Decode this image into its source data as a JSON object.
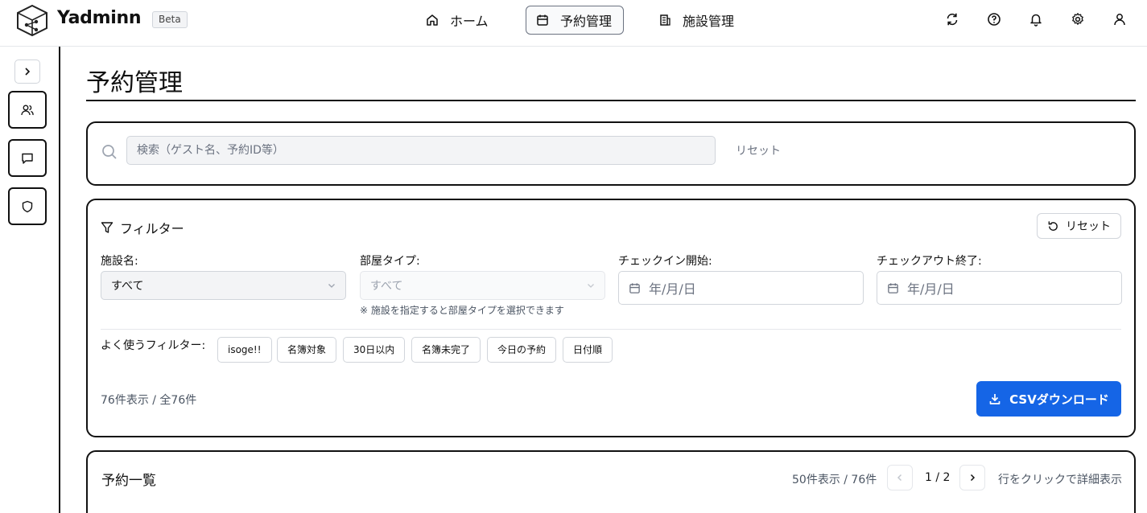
{
  "app": {
    "brand": "Yadminn",
    "badge": "Beta"
  },
  "nav": [
    {
      "label": "ホーム",
      "icon": "home-icon"
    },
    {
      "label": "予約管理",
      "icon": "calendar-icon",
      "active": true
    },
    {
      "label": "施設管理",
      "icon": "building-icon"
    }
  ],
  "header_icons": [
    "refresh-icon",
    "help-icon",
    "bell-icon",
    "gear-icon",
    "user-icon"
  ],
  "sidebar": {
    "items": [
      "users-icon",
      "message-icon",
      "shield-icon"
    ]
  },
  "page": {
    "title": "予約管理"
  },
  "search": {
    "placeholder": "検索（ゲスト名、予約ID等）",
    "value": "",
    "reset_label": "リセット"
  },
  "filters": {
    "title": "フィルター",
    "reset_label": "リセット",
    "facility": {
      "label": "施設名:",
      "value": "すべて"
    },
    "room_type": {
      "label": "部屋タイプ:",
      "value": "すべて",
      "helper": "※ 施設を指定すると部屋タイプを選択できます"
    },
    "checkin": {
      "label": "チェックイン開始:",
      "placeholder": "年/月/日"
    },
    "checkout": {
      "label": "チェックアウト終了:",
      "placeholder": "年/月/日"
    },
    "quick_label": "よく使うフィルター:",
    "quick": [
      "isoge!!",
      "名簿対象",
      "30日以内",
      "名簿未完了",
      "今日の予約",
      "日付順"
    ],
    "count_text": "76件表示 / 全76件",
    "csv_label": "CSVダウンロード"
  },
  "list": {
    "title": "予約一覧",
    "meta": "50件表示 / 76件",
    "page_text": "1 / 2",
    "hint": "行をクリックで詳細表示"
  },
  "colors": {
    "primary": "#1565e6",
    "border": "#111111"
  }
}
